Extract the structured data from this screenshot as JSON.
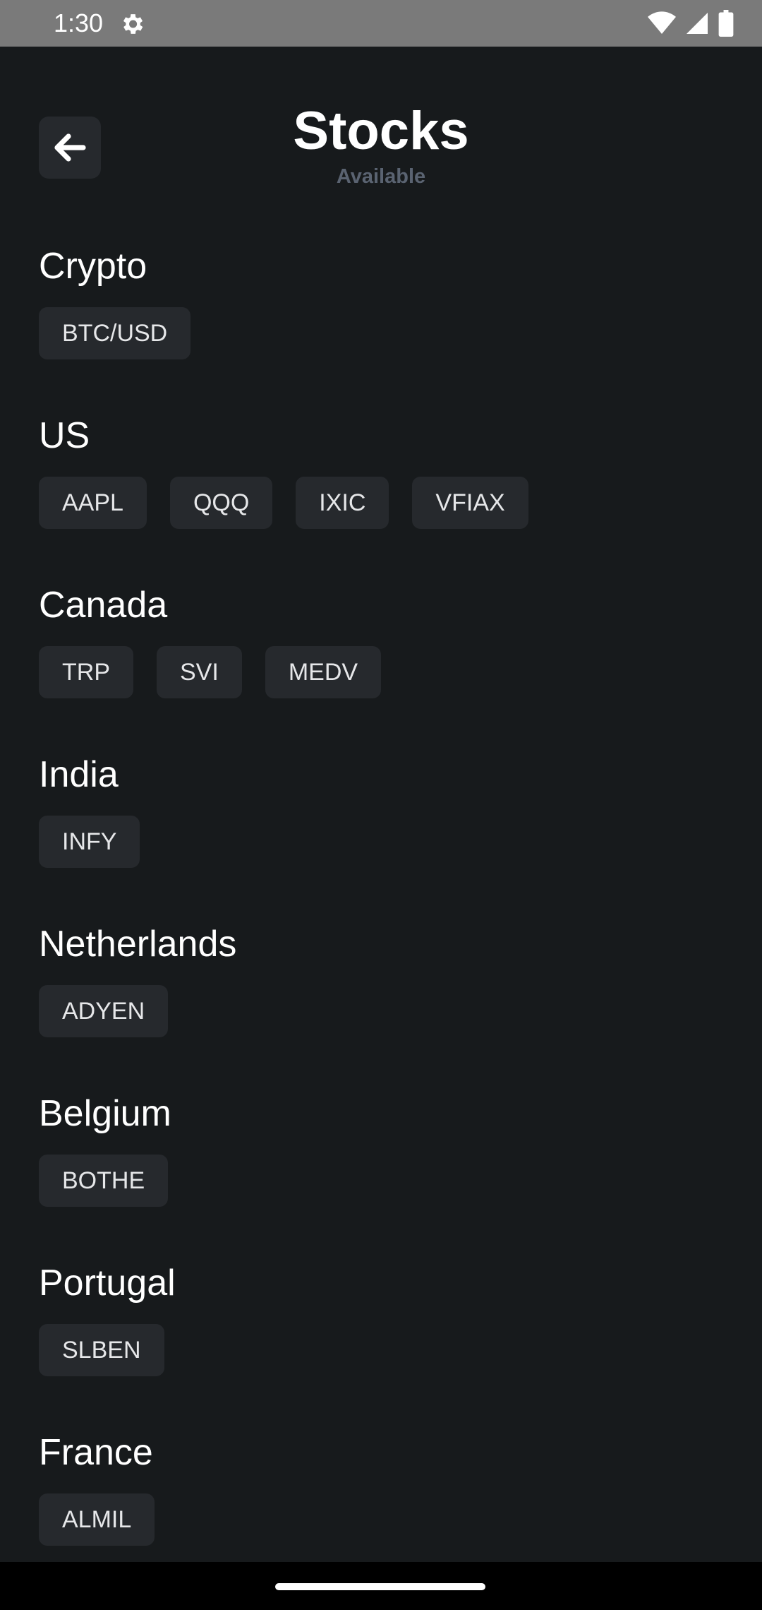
{
  "status_bar": {
    "time": "1:30",
    "icons": [
      "gear-icon",
      "wifi-icon",
      "signal-icon",
      "battery-icon"
    ]
  },
  "header": {
    "back_icon": "arrow-left-icon",
    "title": "Stocks",
    "subtitle": "Available"
  },
  "sections": [
    {
      "title": "Crypto",
      "chips": [
        "BTC/USD"
      ]
    },
    {
      "title": "US",
      "chips": [
        "AAPL",
        "QQQ",
        "IXIC",
        "VFIAX"
      ]
    },
    {
      "title": "Canada",
      "chips": [
        "TRP",
        "SVI",
        "MEDV"
      ]
    },
    {
      "title": "India",
      "chips": [
        "INFY"
      ]
    },
    {
      "title": "Netherlands",
      "chips": [
        "ADYEN"
      ]
    },
    {
      "title": "Belgium",
      "chips": [
        "BOTHE"
      ]
    },
    {
      "title": "Portugal",
      "chips": [
        "SLBEN"
      ]
    },
    {
      "title": "France",
      "chips": [
        "ALMIL"
      ]
    }
  ],
  "colors": {
    "background": "#171a1c",
    "chip_background": "#26292d",
    "subtitle": "#5a6371",
    "status_bar": "#7a7a7a"
  }
}
